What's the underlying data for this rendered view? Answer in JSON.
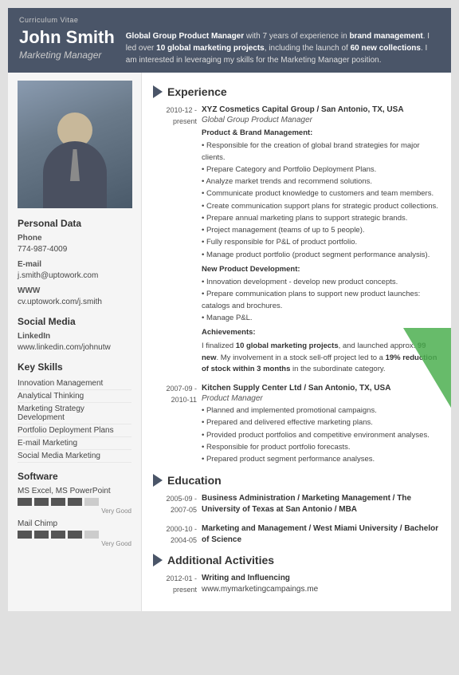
{
  "header": {
    "cv_label": "Curriculum Vitae",
    "name": "John Smith",
    "title": "Marketing Manager",
    "summary": "Global Group Product Manager with 7 years of experience in brand management. I led over 10 global marketing projects, including the launch of 60 new collections. I am interested in leveraging my skills for the Marketing Manager position."
  },
  "left": {
    "personal_data_title": "Personal Data",
    "phone_label": "Phone",
    "phone_value": "774-987-4009",
    "email_label": "E-mail",
    "email_value": "j.smith@uptowork.com",
    "www_label": "WWW",
    "www_value": "cv.uptowork.com/j.smith",
    "social_media_title": "Social Media",
    "linkedin_label": "LinkedIn",
    "linkedin_value": "www.linkedin.com/johnutw",
    "key_skills_title": "Key Skills",
    "skills": [
      "Innovation Management",
      "Analytical Thinking",
      "Marketing Strategy Development",
      "Portfolio Deployment Plans",
      "E-mail Marketing",
      "Social Media Marketing"
    ],
    "software_title": "Software",
    "software_items": [
      {
        "name": "MS Excel, MS PowerPoint",
        "rating": 4,
        "max": 5,
        "label": "Very Good"
      },
      {
        "name": "Mail Chimp",
        "rating": 4,
        "max": 5,
        "label": "Very Good"
      }
    ]
  },
  "experience": {
    "section_title": "Experience",
    "entries": [
      {
        "date": "2010-12 - present",
        "company": "XYZ Cosmetics Capital Group / San Antonio, TX, USA",
        "role": "Global Group Product Manager",
        "subsections": [
          {
            "heading": "Product & Brand Management:",
            "bullets": [
              "Responsible for the creation of global brand strategies for major clients.",
              "Prepare Category and Portfolio Deployment Plans.",
              "Analyze market trends and recommend solutions.",
              "Communicate product knowledge to customers and team members.",
              "Create communication support plans for strategic product collections.",
              "Prepare annual marketing plans to support strategic brands.",
              "Project management (teams of up to 5 people).",
              "Fully responsible for P&L of product portfolio.",
              "Manage product portfolio (product segment performance analysis)."
            ]
          },
          {
            "heading": "New Product Development:",
            "bullets": [
              "Innovation development - develop new product concepts.",
              "Prepare communication plans to support new product launches: catalogs and brochures.",
              "Manage P&L."
            ]
          },
          {
            "heading": "Achievements:",
            "achievement": "I finalized 10 global marketing projects, and launched approx. 99 new collections. My involvement in a stock sell-off project led to a 19% reduction of stock within 3 months in the subordinate category."
          }
        ]
      },
      {
        "date": "2007-09 - 2010-11",
        "company": "Kitchen Supply Center Ltd / San Antonio, TX, USA",
        "role": "Product Manager",
        "bullets": [
          "Planned and implemented promotional campaigns.",
          "Prepared and delivered effective marketing plans.",
          "Provided product portfolios and competitive environment analyses.",
          "Responsible for product portfolio forecasts.",
          "Prepared product segment performance analyses."
        ]
      }
    ]
  },
  "education": {
    "section_title": "Education",
    "entries": [
      {
        "date": "2005-09 - 2007-05",
        "title": "Business Administration / Marketing Management / The University of Texas at San Antonio / MBA"
      },
      {
        "date": "2000-10 - 2004-05",
        "title": "Marketing and Management / West Miami University / Bachelor of Science"
      }
    ]
  },
  "additional": {
    "section_title": "Additional Activities",
    "entries": [
      {
        "date": "2012-01 - present",
        "title": "Writing and Influencing",
        "value": "www.mymarketingcampaings.me"
      }
    ]
  }
}
